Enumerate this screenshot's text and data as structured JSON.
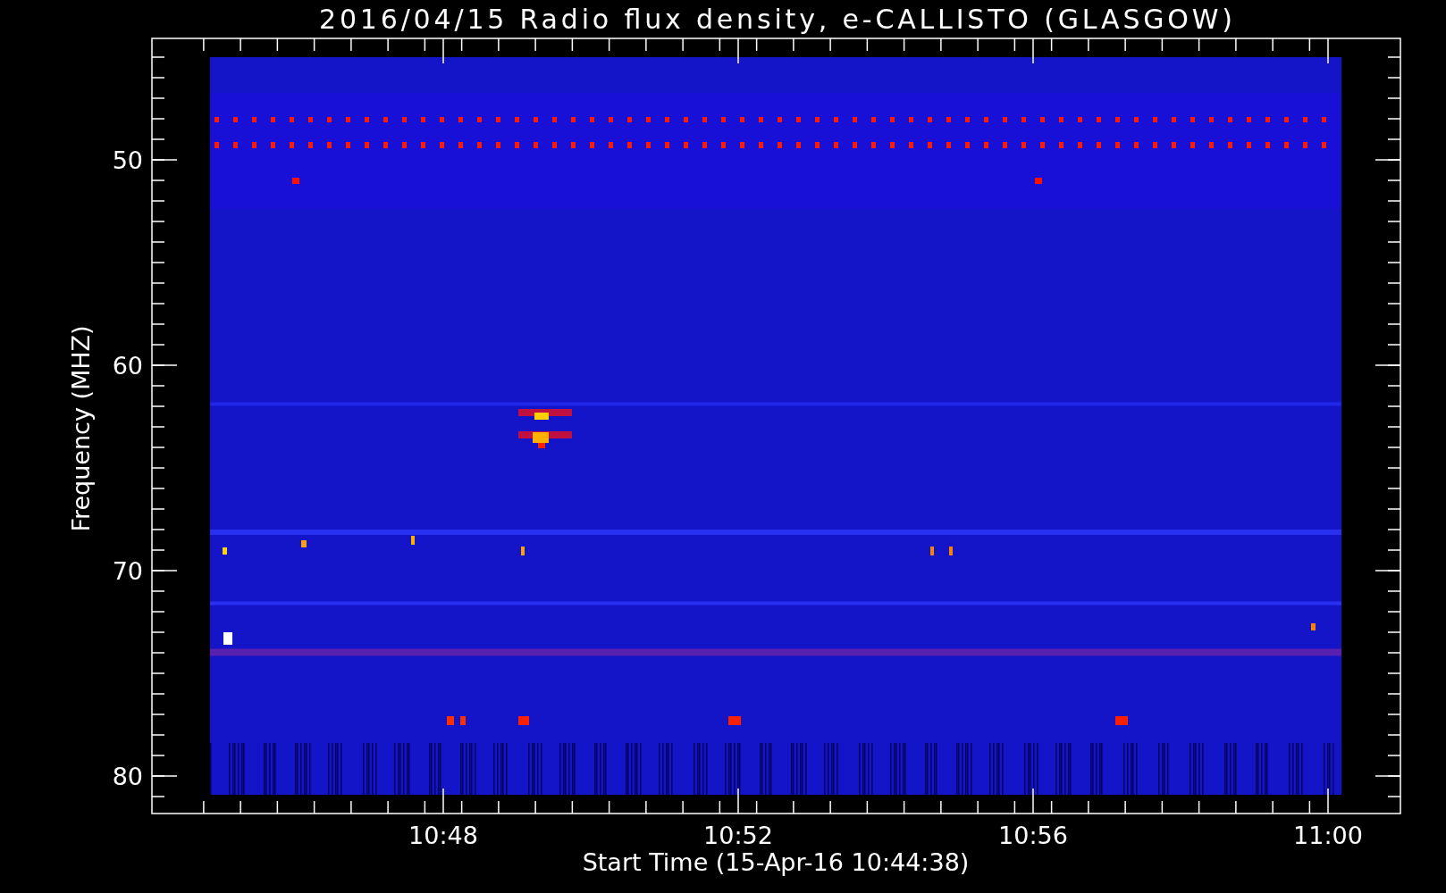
{
  "title": "2016/04/15  Radio flux density, e-CALLISTO (GLASGOW)",
  "y_axis": {
    "label": "Frequency (MHZ)",
    "tick_labels": [
      "50",
      "60",
      "70",
      "80"
    ]
  },
  "x_axis": {
    "label": "Start Time (15-Apr-16 10:44:38)",
    "tick_labels": [
      "10:48",
      "10:52",
      "10:56",
      "11:00"
    ]
  }
}
